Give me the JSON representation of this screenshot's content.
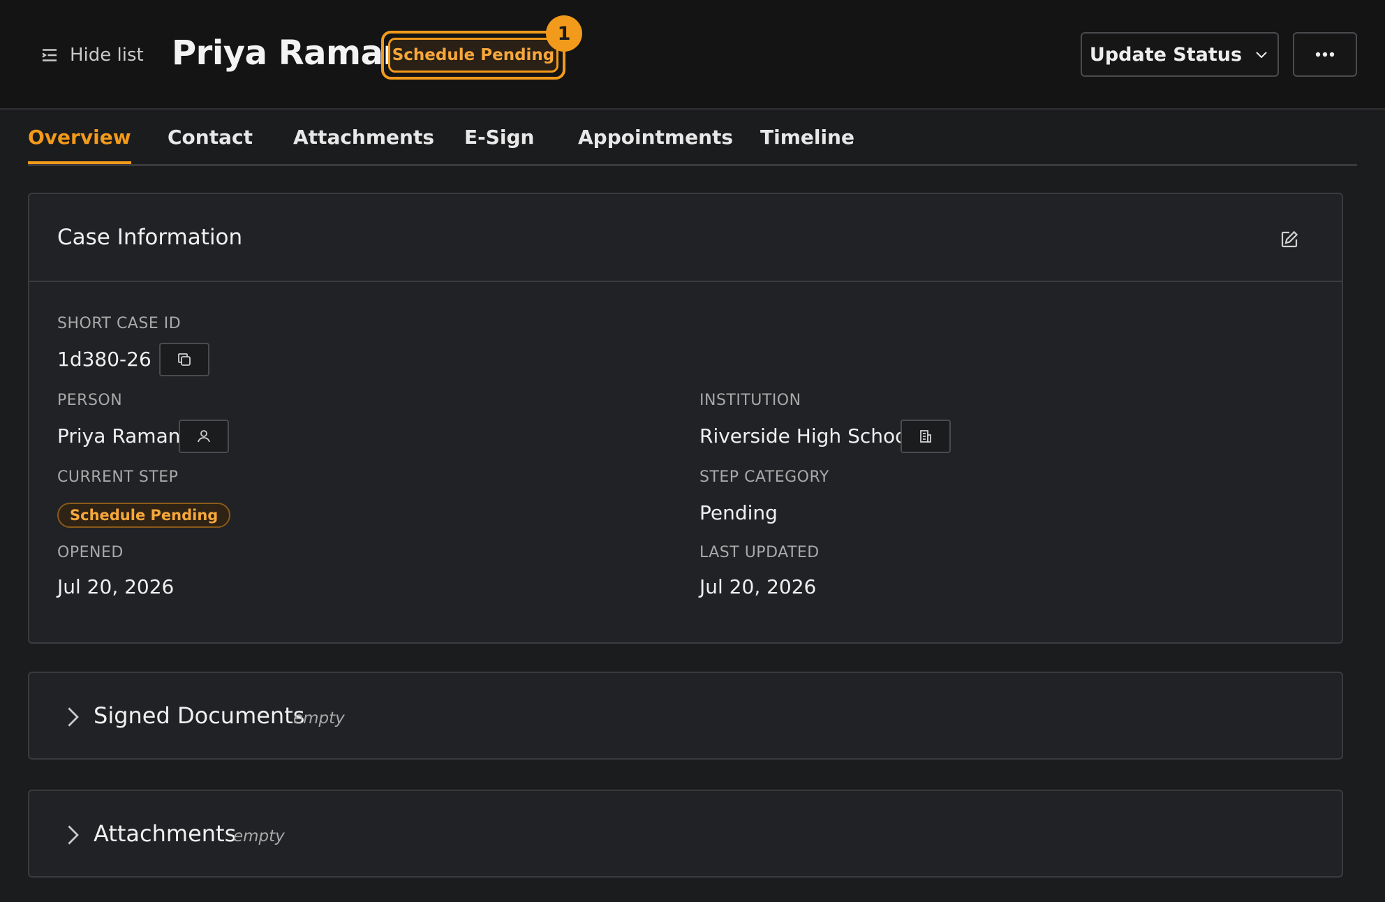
{
  "header": {
    "hide_list_label": "Hide list",
    "title": "Priya Raman",
    "status_chip": "Schedule Pending",
    "badge_count": "1",
    "update_status_label": "Update Status",
    "more_label": "•••"
  },
  "tabs": [
    {
      "label": "Overview",
      "active": true
    },
    {
      "label": "Contact",
      "active": false
    },
    {
      "label": "Attachments",
      "active": false
    },
    {
      "label": "E-Sign",
      "active": false
    },
    {
      "label": "Appointments",
      "active": false
    },
    {
      "label": "Timeline",
      "active": false
    }
  ],
  "case_info": {
    "title": "Case Information",
    "short_case_id_label": "SHORT CASE ID",
    "short_case_id": "1d380-26",
    "person_label": "PERSON",
    "person": "Priya Raman",
    "institution_label": "INSTITUTION",
    "institution": "Riverside High School",
    "current_step_label": "CURRENT STEP",
    "current_step": "Schedule Pending",
    "step_category_label": "STEP CATEGORY",
    "step_category": "Pending",
    "opened_label": "OPENED",
    "opened": "Jul 20, 2026",
    "last_updated_label": "LAST UPDATED",
    "last_updated": "Jul 20, 2026"
  },
  "sections": [
    {
      "title": "Signed Documents",
      "state": "empty"
    },
    {
      "title": "Attachments",
      "state": "empty"
    }
  ],
  "colors": {
    "accent": "#f29a1b",
    "background": "#1b1c1e",
    "card": "#212225"
  },
  "icons": {
    "hide_list": "list-indent-icon",
    "dropdown": "chevron-down-icon",
    "more": "ellipsis-icon",
    "edit": "edit-icon",
    "copy": "copy-icon",
    "person": "user-icon",
    "institution": "building-icon",
    "expand": "chevron-right-icon"
  }
}
